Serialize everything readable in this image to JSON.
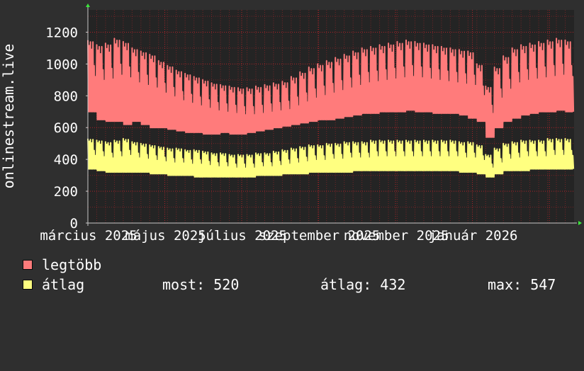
{
  "colors": {
    "background": "#2f2f2f",
    "plot_background": "#242424",
    "grid": "#b3242a",
    "axis": "#c8c8c8",
    "text": "#ffffff",
    "arrow": "#3ce63c",
    "max_series": "#ff7b7b",
    "avg_series": "#ffff80"
  },
  "chart_data": {
    "type": "line",
    "ylabel": "onlinestream.live",
    "ylim": [
      0,
      1340
    ],
    "y_ticks": [
      0,
      200,
      400,
      600,
      800,
      1000,
      1200
    ],
    "y_tick_labels": [
      "0",
      "200",
      "400",
      "600",
      "800",
      "1000",
      "1200"
    ],
    "x_range_weeks": [
      0,
      55
    ],
    "x_ticks": [
      0,
      8.7,
      17.4,
      26.1,
      34.8,
      43.5,
      52.2
    ],
    "x_tick_labels": [
      "március 2025",
      "május 2025",
      "július 2025",
      "szeptember 2025",
      "november 2025",
      "január 2026"
    ],
    "x_tick_label_positions": [
      0,
      8.7,
      17.4,
      26.1,
      34.8,
      43.5
    ],
    "grid": true,
    "series": [
      {
        "name": "legtöbb",
        "color": "#ff7b7b",
        "weekly_peak": [
          1150,
          1120,
          1130,
          1160,
          1140,
          1100,
          1080,
          1060,
          1020,
          990,
          960,
          940,
          920,
          900,
          880,
          870,
          860,
          850,
          850,
          860,
          870,
          880,
          890,
          920,
          950,
          980,
          1000,
          1020,
          1040,
          1060,
          1080,
          1100,
          1110,
          1120,
          1130,
          1140,
          1150,
          1140,
          1130,
          1120,
          1110,
          1100,
          1090,
          1080,
          1000,
          860,
          980,
          1050,
          1100,
          1120,
          1130,
          1140,
          1150,
          1160,
          1150,
          1140
        ],
        "weekly_low": [
          700,
          650,
          640,
          640,
          620,
          640,
          620,
          600,
          600,
          590,
          580,
          570,
          570,
          560,
          560,
          570,
          560,
          560,
          570,
          580,
          590,
          600,
          610,
          620,
          630,
          640,
          650,
          650,
          660,
          670,
          680,
          690,
          690,
          700,
          700,
          700,
          710,
          700,
          700,
          690,
          690,
          690,
          680,
          660,
          640,
          540,
          600,
          640,
          660,
          680,
          690,
          700,
          700,
          710,
          700,
          700
        ]
      },
      {
        "name": "átlag",
        "color": "#ffff80",
        "weekly_peak": [
          530,
          520,
          510,
          520,
          530,
          510,
          500,
          490,
          480,
          470,
          470,
          460,
          460,
          450,
          440,
          440,
          430,
          430,
          430,
          440,
          440,
          450,
          460,
          470,
          480,
          490,
          490,
          500,
          500,
          510,
          510,
          510,
          520,
          520,
          520,
          520,
          520,
          520,
          520,
          520,
          520,
          520,
          510,
          510,
          490,
          430,
          470,
          500,
          510,
          520,
          520,
          520,
          530,
          530,
          530,
          520
        ],
        "weekly_low": [
          340,
          330,
          320,
          320,
          320,
          320,
          320,
          310,
          310,
          300,
          300,
          300,
          290,
          290,
          290,
          290,
          290,
          290,
          290,
          300,
          300,
          300,
          310,
          310,
          310,
          320,
          320,
          320,
          320,
          320,
          330,
          330,
          330,
          330,
          330,
          330,
          330,
          330,
          330,
          330,
          330,
          330,
          320,
          320,
          310,
          290,
          310,
          330,
          330,
          330,
          340,
          340,
          340,
          340,
          340,
          340
        ]
      }
    ]
  },
  "legend": {
    "items": [
      {
        "label": "legtöbb",
        "color": "#ff7b7b"
      },
      {
        "label": "átlag",
        "color": "#ffff80"
      }
    ],
    "stats": {
      "current": "most: 520",
      "average": "átlag: 432",
      "max": "max: 547"
    }
  }
}
